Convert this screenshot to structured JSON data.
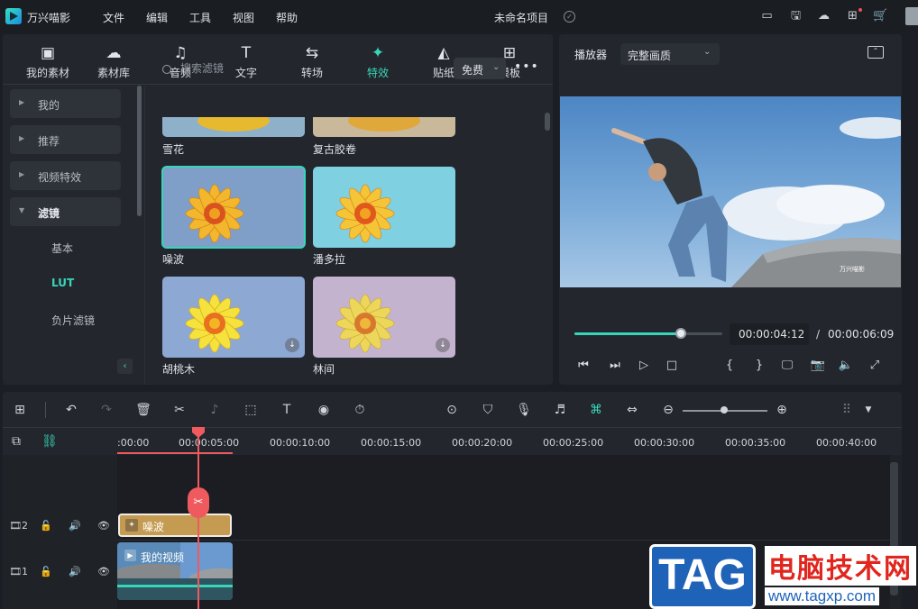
{
  "app": {
    "name": "万兴喵影",
    "project_title": "未命名项目"
  },
  "menu": [
    "文件",
    "编辑",
    "工具",
    "视图",
    "帮助"
  ],
  "top_tabs": [
    {
      "label": "我的素材",
      "icon": "folder-image-icon"
    },
    {
      "label": "素材库",
      "icon": "cloud-library-icon"
    },
    {
      "label": "音频",
      "icon": "music-note-icon"
    },
    {
      "label": "文字",
      "icon": "text-t-icon"
    },
    {
      "label": "转场",
      "icon": "transition-icon"
    },
    {
      "label": "特效",
      "icon": "effects-sparkle-icon",
      "active": true
    },
    {
      "label": "贴纸",
      "icon": "sticker-icon"
    },
    {
      "label": "模板",
      "icon": "template-grid-icon"
    }
  ],
  "sidebar": {
    "items": [
      {
        "label": "我的"
      },
      {
        "label": "推荐"
      },
      {
        "label": "视频特效"
      },
      {
        "label": "滤镜",
        "expanded": true
      }
    ],
    "sub_items": [
      {
        "label": "基本"
      },
      {
        "label": "LUT",
        "selected": true
      },
      {
        "label": "负片滤镜"
      }
    ]
  },
  "search": {
    "placeholder": "搜索滤镜",
    "value": ""
  },
  "filter_dropdown": {
    "selected": "免费"
  },
  "effects": [
    {
      "label": "雪花"
    },
    {
      "label": "复古胶卷"
    },
    {
      "label": "噪波",
      "selected": true
    },
    {
      "label": "潘多拉"
    },
    {
      "label": "胡桃木",
      "downloadable": true
    },
    {
      "label": "林间",
      "downloadable": true
    }
  ],
  "player": {
    "label": "播放器",
    "quality": "完整画质",
    "current_time": "00:00:04:12",
    "separator": "/",
    "total_time": "00:00:06:09",
    "progress": 0.72,
    "video_watermark": "万兴喵影"
  },
  "timeline": {
    "ruler": [
      ":00:00",
      "00:00:05:00",
      "00:00:10:00",
      "00:00:15:00",
      "00:00:20:00",
      "00:00:25:00",
      "00:00:30:00",
      "00:00:35:00",
      "00:00:40:00"
    ],
    "tracks": [
      {
        "number": "2",
        "clip_label": "噪波"
      },
      {
        "number": "1",
        "clip_label": "我的视频"
      }
    ]
  },
  "watermark": {
    "tag": "TAG",
    "title": "电脑技术网",
    "url": "www.tagxp.com"
  },
  "colors": {
    "accent": "#37d6b8",
    "playhead": "#ef5a5e",
    "fx_clip": "#c59b52"
  }
}
